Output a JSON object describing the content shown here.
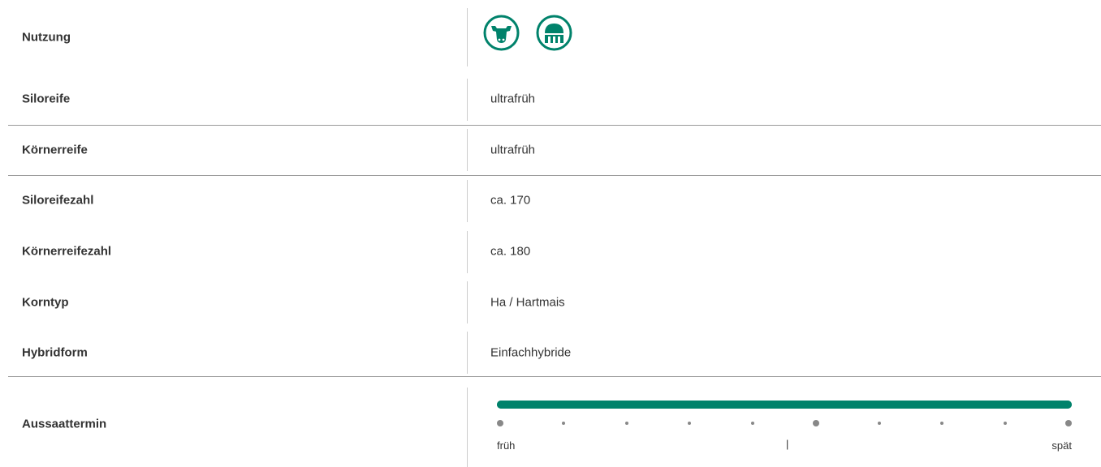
{
  "rows": [
    {
      "label": "Nutzung",
      "value": ""
    },
    {
      "label": "Siloreife",
      "value": "ultrafrüh"
    },
    {
      "label": "Körnerreife",
      "value": "ultrafrüh"
    },
    {
      "label": "Siloreifezahl",
      "value": "ca. 170"
    },
    {
      "label": "Körnerreifezahl",
      "value": "ca. 180"
    },
    {
      "label": "Korntyp",
      "value": "Ha / Hartmais"
    },
    {
      "label": "Hybridform",
      "value": "Einfachhybride"
    },
    {
      "label": "Aussaattermin",
      "value": ""
    }
  ],
  "usage_icons": [
    "cow-icon",
    "silo-icon"
  ],
  "aussaattermin": {
    "start_label": "früh",
    "end_label": "spät",
    "marker": "|",
    "range_fraction": [
      0.0,
      1.0
    ],
    "steps": 10,
    "major_steps": [
      0,
      5,
      9
    ],
    "accent_color": "#00826b"
  }
}
